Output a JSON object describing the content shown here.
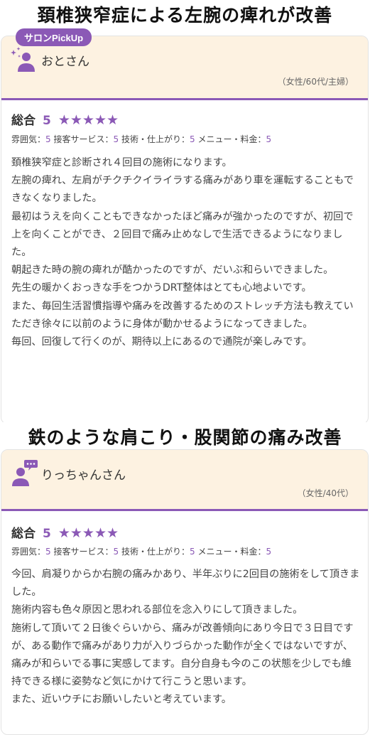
{
  "headline1": "頚椎狭窄症による左腕の痺れが改善",
  "headline2": "鉄のような肩こり・股関節の痛み改善",
  "pickup_label": "サロンPickUp",
  "reviews": [
    {
      "reviewer": "おとさん",
      "demographic": "（女性/60代/主婦）",
      "overall_label": "総合",
      "score": "5",
      "stars": "★★★★★",
      "subs": [
        {
          "label": "雰囲気：",
          "value": "5"
        },
        {
          "label": "接客サービス：",
          "value": "5"
        },
        {
          "label": "技術・仕上がり：",
          "value": "5"
        },
        {
          "label": "メニュー・料金：",
          "value": "5"
        }
      ],
      "paragraphs": [
        "頚椎狭窄症と診断され４回目の施術になります。",
        "左腕の痺れ、左肩がチクチクイライラする痛みがあり車を運転することもできなくなりました。",
        "最初はうえを向くこともできなかったほど痛みが強かったのですが、初回で上を向くことができ、２回目で痛み止めなしで生活できるようになりました。",
        "朝起きた時の腕の痺れが酷かったのですが、だいぶ和らいできました。",
        "先生の暖かくおっきな手をつかうDRT整体はとても心地よいです。",
        "また、毎回生活習慣指導や痛みを改善するためのストレッチ方法も教えていただき徐々に以前のように身体が動かせるようになってきました。",
        "毎回、回復して行くのが、期待以上にあるので通院が楽しみです。"
      ]
    },
    {
      "reviewer": "りっちゃんさん",
      "demographic": "（女性/40代）",
      "overall_label": "総合",
      "score": "5",
      "stars": "★★★★★",
      "subs": [
        {
          "label": "雰囲気：",
          "value": "5"
        },
        {
          "label": "接客サービス：",
          "value": "5"
        },
        {
          "label": "技術・仕上がり：",
          "value": "5"
        },
        {
          "label": "メニュー・料金：",
          "value": "5"
        }
      ],
      "paragraphs": [
        "今回、肩凝りからか右腕の痛みかあり、半年ぶりに2回目の施術をして頂きました。",
        "施術内容も色々原因と思われる部位を念入りにして頂きました。",
        "施術して頂いて２日後ぐらいから、痛みが改善傾向にあり今日で３日目ですが、ある動作で痛みがあり力が入りづらかった動作が全くではないですが、痛みが和らいでる事に実感してます。自分自身も今のこの状態を少しでも維持できる様に姿勢など気にかけて行こうと思います。",
        "また、近いウチにお願いしたいと考えています。"
      ]
    }
  ],
  "colors": {
    "accent": "#8b59b6",
    "header_bg": "#fdf2e1"
  }
}
